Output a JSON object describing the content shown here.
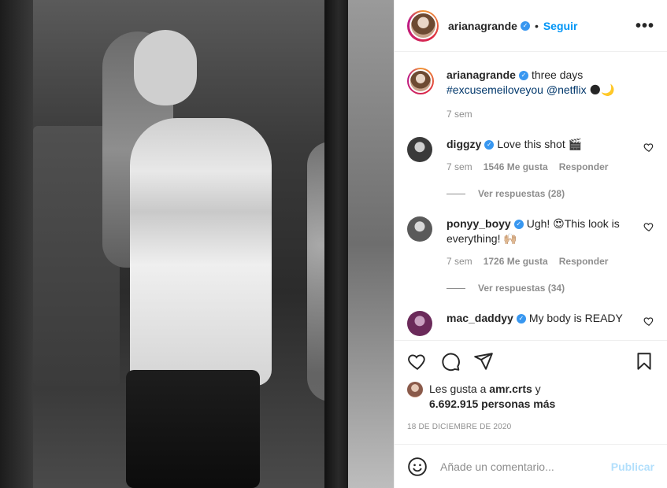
{
  "header": {
    "username": "arianagrande",
    "separator": "•",
    "follow_label": "Seguir",
    "more_label": "•••"
  },
  "caption": {
    "username": "arianagrande",
    "text": "three days",
    "hashtag": "#excusemeiloveyou",
    "mention": "@netflix",
    "emoji": "🌑🌙",
    "time": "7 sem"
  },
  "comments": [
    {
      "username": "diggzy",
      "text": "Love this shot 🎬",
      "time": "7 sem",
      "likes": "1546 Me gusta",
      "reply_label": "Responder",
      "view_replies": "Ver respuestas (28)",
      "avatar_color": "#3a3a3a"
    },
    {
      "username": "ponyy_boyy",
      "text": "Ugh! 😍This look is everything! 🙌🏼",
      "time": "7 sem",
      "likes": "1726 Me gusta",
      "reply_label": "Responder",
      "view_replies": "Ver respuestas (34)",
      "avatar_color": "#5a5a5a"
    },
    {
      "username": "mac_daddyy",
      "text": "My body is READY",
      "avatar_color": "#6b2a5a"
    }
  ],
  "likes_block": {
    "prefix": "Les gusta a",
    "user": "amr.crts",
    "middle": "y",
    "count": "6.692.915 personas más"
  },
  "date": "18 DE DICIEMBRE DE 2020",
  "add_comment": {
    "placeholder": "Añade un comentario...",
    "publish_label": "Publicar"
  },
  "colors": {
    "accent": "#0095f6",
    "verified": "#3897f0",
    "publish_disabled": "#b2dffc",
    "muted": "#8e8e8e",
    "text": "#262626"
  }
}
